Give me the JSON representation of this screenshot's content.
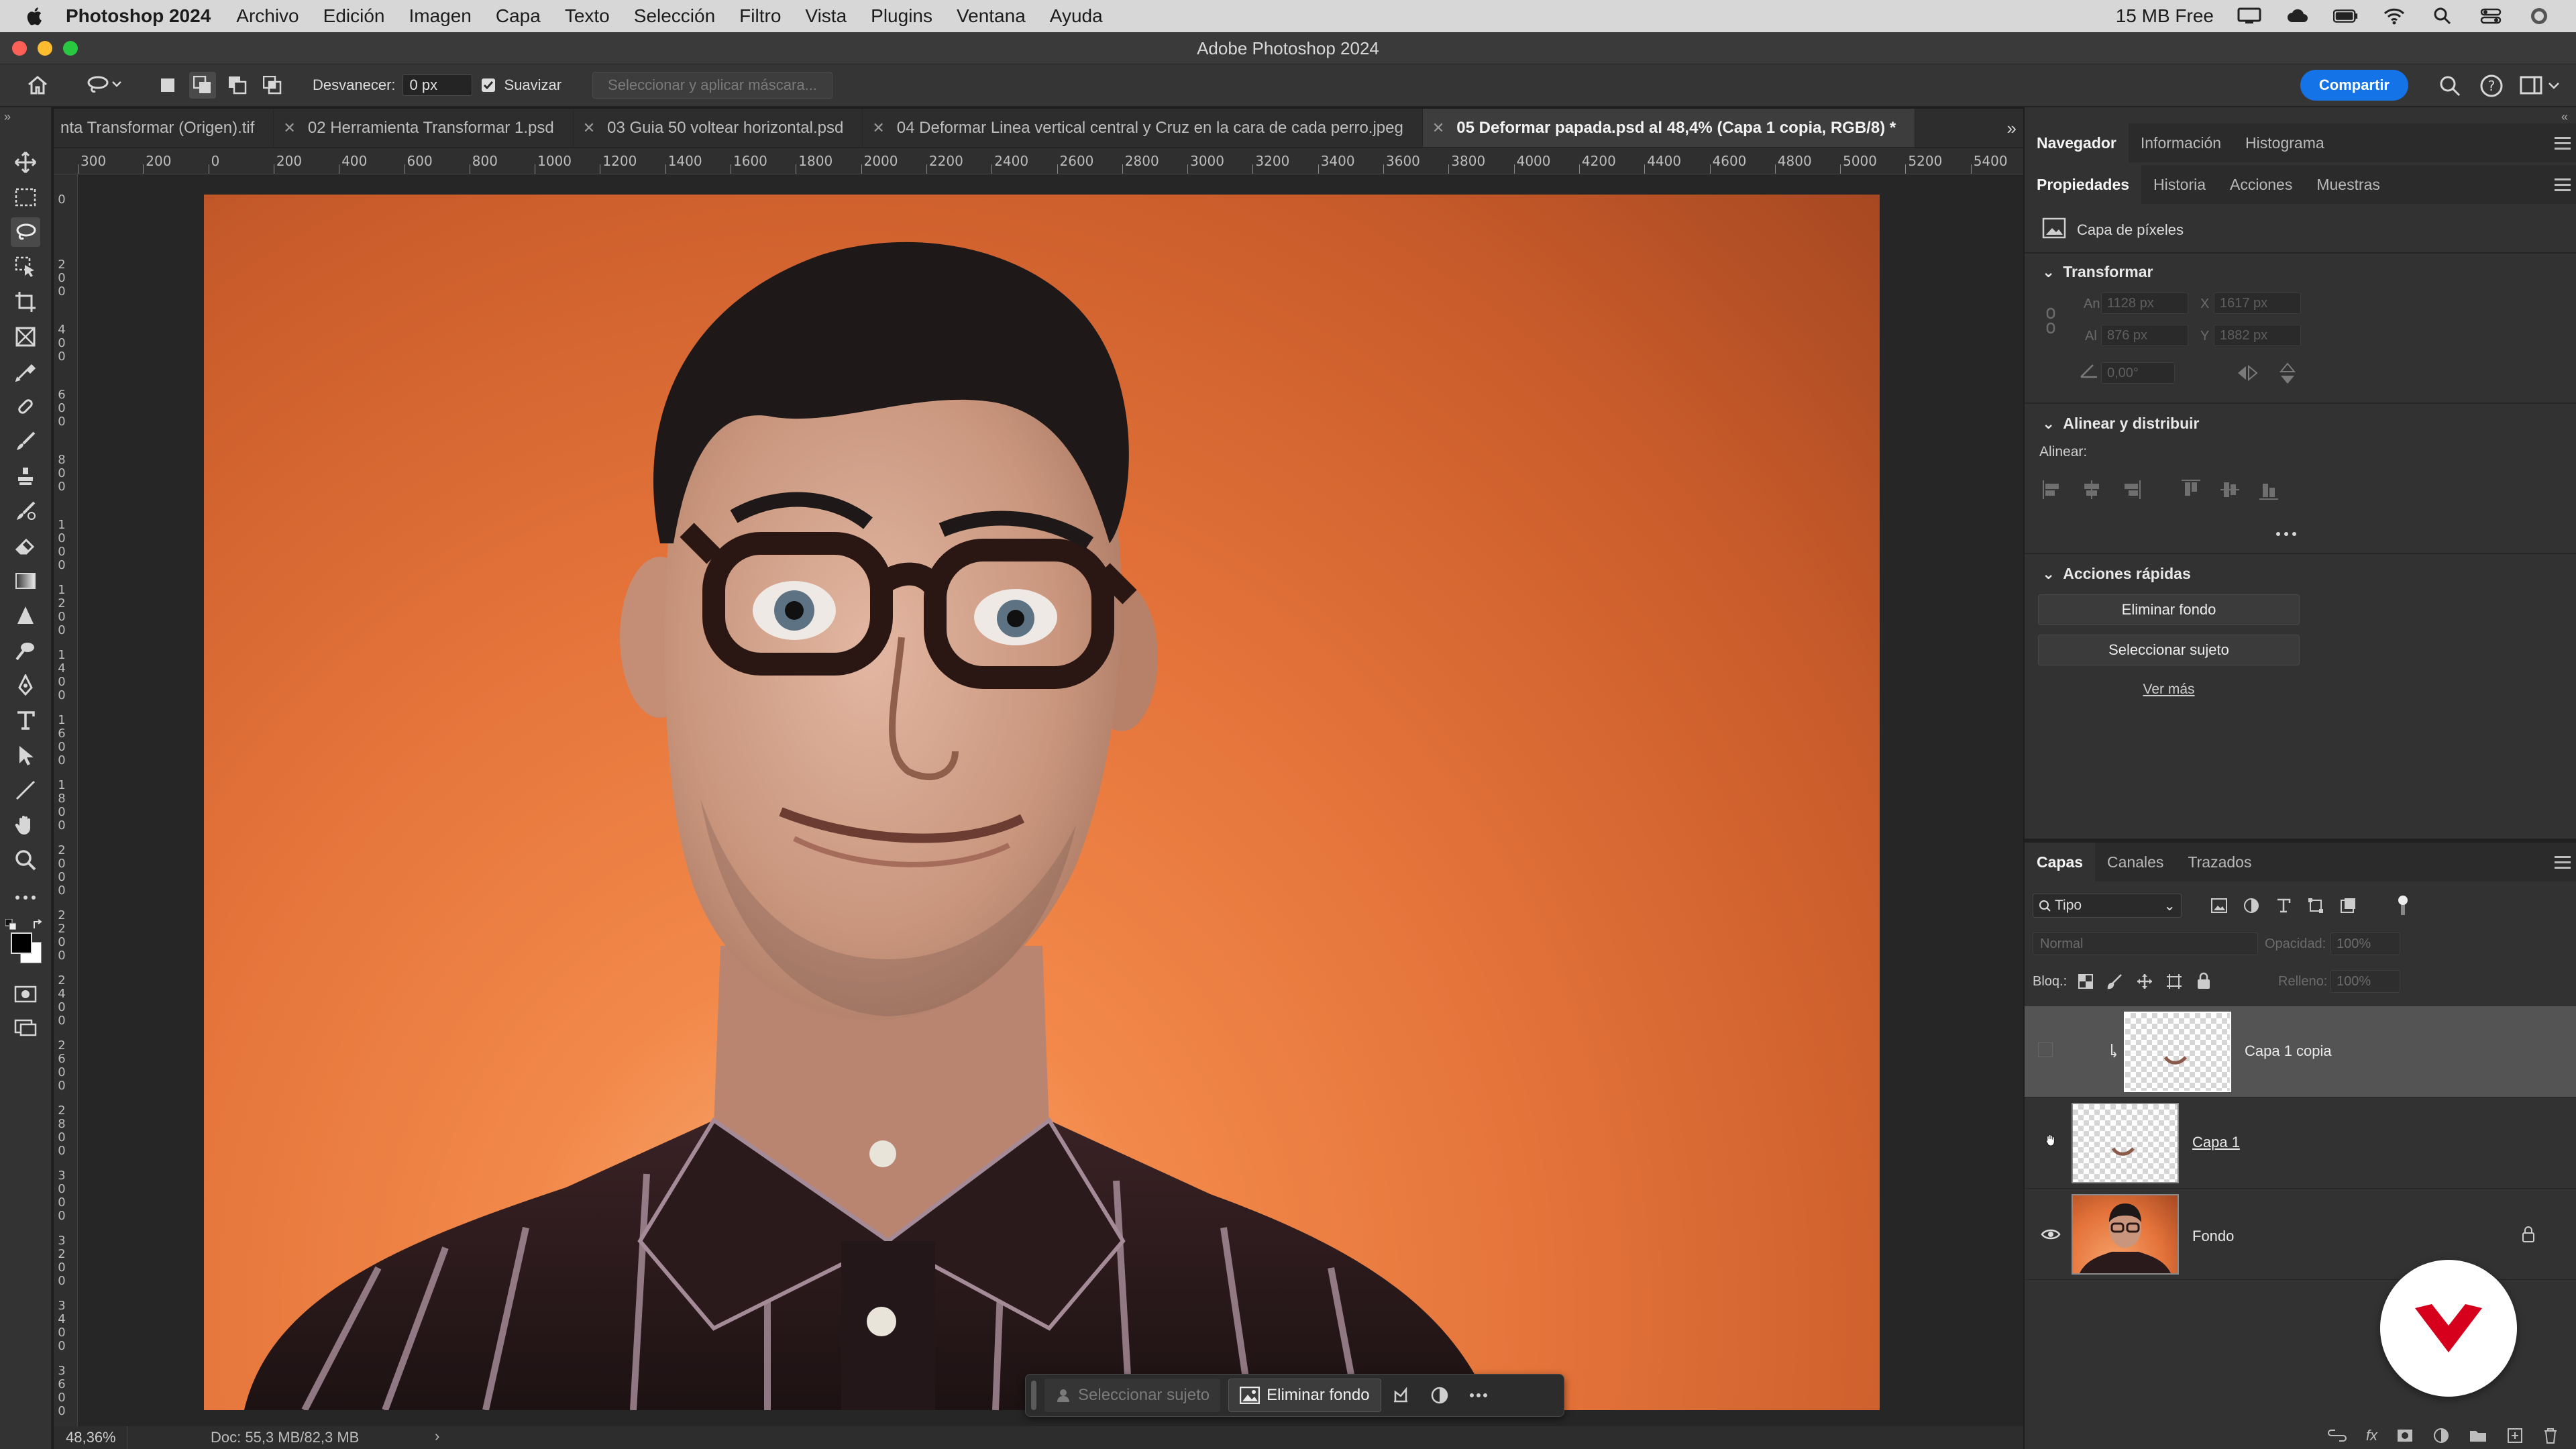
{
  "menubar": {
    "app_name": "Photoshop 2024",
    "items": [
      "Archivo",
      "Edición",
      "Imagen",
      "Capa",
      "Texto",
      "Selección",
      "Filtro",
      "Vista",
      "Plugins",
      "Ventana",
      "Ayuda"
    ],
    "memory": "15 MB Free"
  },
  "window": {
    "title": "Adobe Photoshop 2024"
  },
  "options": {
    "feather_label": "Desvanecer:",
    "feather_value": "0 px",
    "antialias_label": "Suavizar",
    "antialias_checked": true,
    "select_mask_label": "Seleccionar y aplicar máscara...",
    "share_label": "Compartir"
  },
  "doc_tabs": [
    {
      "label": "nta Transformar (Origen).tif",
      "active": false
    },
    {
      "label": "02 Herramienta Transformar 1.psd",
      "active": false
    },
    {
      "label": "03 Guia 50 voltear horizontal.psd",
      "active": false
    },
    {
      "label": "04 Deformar Linea vertical central y Cruz en la cara de cada perro.jpeg",
      "active": false
    },
    {
      "label": "05 Deformar papada.psd al 48,4% (Capa 1 copia, RGB/8) *",
      "active": true
    }
  ],
  "ruler_top": [
    "300",
    "200",
    "0",
    "200",
    "400",
    "600",
    "800",
    "1000",
    "1200",
    "1400",
    "1600",
    "1800",
    "2000",
    "2200",
    "2400",
    "2600",
    "2800",
    "3000",
    "3200",
    "3400",
    "3600",
    "3800",
    "4000",
    "4200",
    "4400",
    "4600",
    "4800",
    "5000",
    "5200",
    "5400"
  ],
  "ruler_left": [
    "0",
    "200",
    "400",
    "600",
    "800",
    "1000",
    "1200",
    "1400",
    "1600",
    "1800",
    "2000",
    "2200",
    "2400",
    "2600",
    "2800",
    "3000",
    "3200",
    "3400",
    "3600"
  ],
  "taskbar": {
    "select_subject": "Seleccionar sujeto",
    "remove_bg": "Eliminar fondo"
  },
  "status": {
    "zoom": "48,36%",
    "doc": "Doc: 55,3 MB/82,3 MB"
  },
  "panel_top": {
    "tabs": [
      "Navegador",
      "Información",
      "Histograma"
    ],
    "active": "Navegador"
  },
  "properties": {
    "tabs": [
      "Propiedades",
      "Historia",
      "Acciones",
      "Muestras"
    ],
    "active": "Propiedades",
    "layer_type": "Capa de píxeles",
    "transform_title": "Transformar",
    "w_label": "An",
    "w_value": "1128 px",
    "x_label": "X",
    "x_value": "1617 px",
    "h_label": "Al",
    "h_value": "876 px",
    "y_label": "Y",
    "y_value": "1882 px",
    "angle_value": "0,00°",
    "align_title": "Alinear y distribuir",
    "align_label": "Alinear:",
    "quick_title": "Acciones rápidas",
    "quick_btn1": "Eliminar fondo",
    "quick_btn2": "Seleccionar sujeto",
    "see_more": "Ver más"
  },
  "layers": {
    "tabs": [
      "Capas",
      "Canales",
      "Trazados"
    ],
    "active": "Capas",
    "filter": "Tipo",
    "blend_mode": "Normal",
    "opacity_label": "Opacidad:",
    "opacity_value": "100%",
    "lock_label": "Bloq.:",
    "fill_label": "Relleno:",
    "fill_value": "100%",
    "items": [
      {
        "name": "Capa 1 copia",
        "selected": true,
        "visible": false
      },
      {
        "name": "Capa 1",
        "selected": false,
        "visible": true
      },
      {
        "name": "Fondo",
        "selected": false,
        "visible": true,
        "locked": true
      }
    ]
  },
  "colors": {
    "accent": "#1473e6",
    "photo_bg": "#e4733a",
    "logo_red": "#d6001c"
  }
}
